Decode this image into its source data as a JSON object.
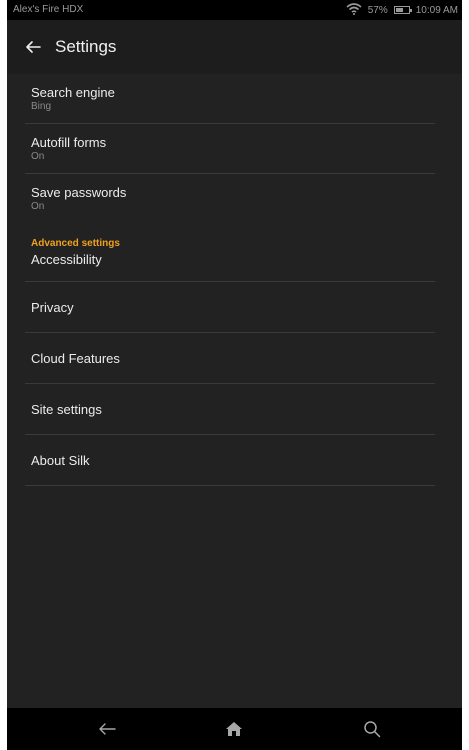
{
  "status_bar": {
    "device_name": "Alex's Fire HDX",
    "battery_percent": "57%",
    "battery_level": 0.57,
    "time": "10:09 AM"
  },
  "header": {
    "title": "Settings",
    "back_icon": "back-arrow-icon"
  },
  "settings": {
    "items": [
      {
        "label": "Search engine",
        "value": "Bing"
      },
      {
        "label": "Autofill forms",
        "value": "On"
      },
      {
        "label": "Save passwords",
        "value": "On"
      }
    ],
    "advanced_header": "Advanced settings",
    "advanced_items": [
      {
        "label": "Accessibility"
      },
      {
        "label": "Privacy"
      },
      {
        "label": "Cloud Features"
      },
      {
        "label": "Site settings"
      },
      {
        "label": "About Silk"
      }
    ]
  },
  "nav": {
    "back_icon": "back-arrow-icon",
    "home_icon": "home-icon",
    "search_icon": "search-icon"
  },
  "colors": {
    "background": "#222222",
    "header": "#1d1d1d",
    "accent": "#f0a21e",
    "text": "#ececec",
    "subtext": "#8a8a8a"
  }
}
